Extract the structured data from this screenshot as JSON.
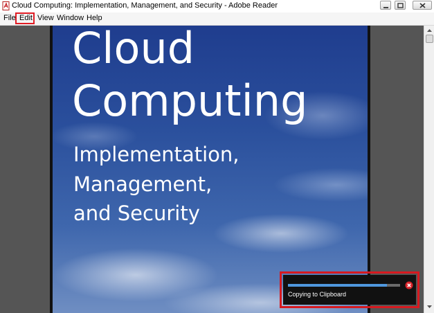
{
  "window": {
    "title": "Cloud Computing: Implementation, Management, and Security - Adobe Reader"
  },
  "menu": {
    "items": [
      "File",
      "Edit",
      "View",
      "Window",
      "Help"
    ],
    "highlighted": "Edit",
    "close_doc": "×"
  },
  "cover": {
    "title_line1": "Cloud",
    "title_line2": "Computing",
    "subtitle_line1": "Implementation,",
    "subtitle_line2": "Management,",
    "subtitle_line3": "and Security"
  },
  "toast": {
    "message": "Copying to Clipboard",
    "progress": 0.88
  },
  "colors": {
    "highlight_red": "#e01c24",
    "progress_blue": "#4f97dd",
    "doc_background": "#555555"
  },
  "icons": [
    "pdf-app-icon",
    "minimize-icon",
    "maximize-icon",
    "window-close-icon",
    "scroll-up-arrow-icon",
    "scroll-down-arrow-icon",
    "cancel-icon"
  ]
}
